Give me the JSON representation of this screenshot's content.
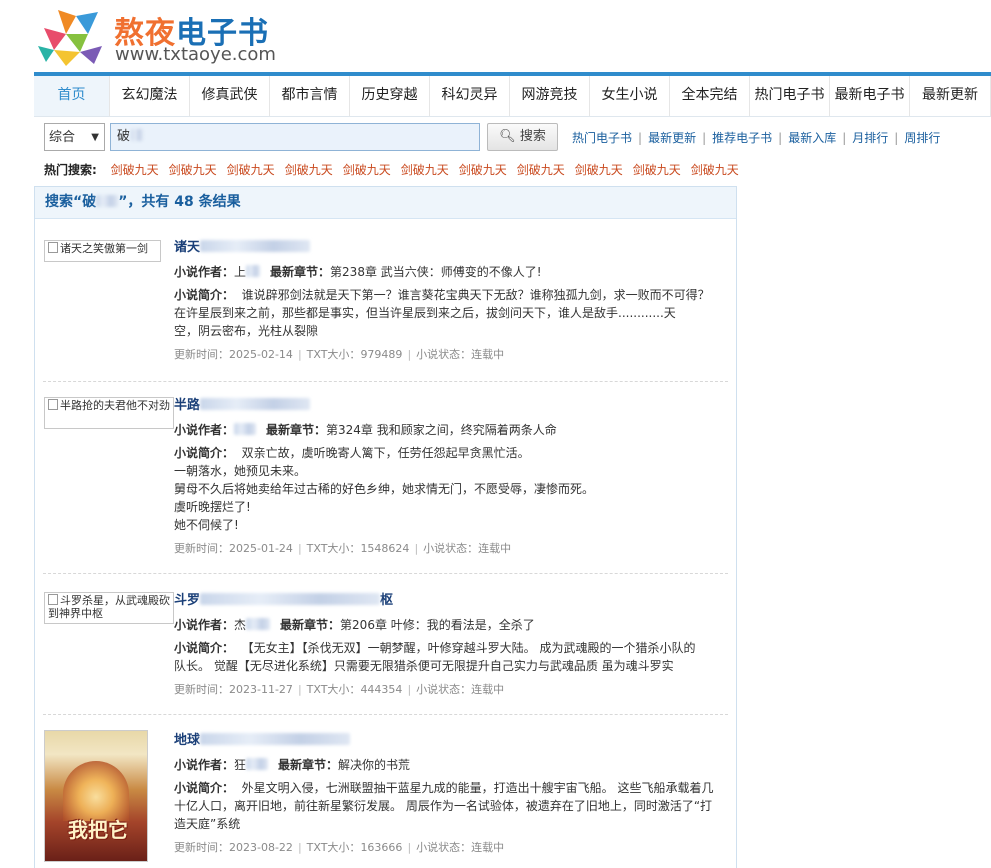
{
  "site": {
    "name_part1": "熬夜",
    "name_part2": "电子书",
    "url": "www.txtaoye.com"
  },
  "nav": [
    {
      "label": "首页",
      "active": true
    },
    {
      "label": "玄幻魔法"
    },
    {
      "label": "修真武侠"
    },
    {
      "label": "都市言情"
    },
    {
      "label": "历史穿越"
    },
    {
      "label": "科幻灵异"
    },
    {
      "label": "网游竞技"
    },
    {
      "label": "女生小说"
    },
    {
      "label": "全本完结"
    },
    {
      "label": "热门电子书"
    },
    {
      "label": "最新电子书"
    },
    {
      "label": "最新更新"
    }
  ],
  "search": {
    "category_selected": "综合",
    "query": "破",
    "button_label": "搜索"
  },
  "quick_links": [
    "热门电子书",
    "最新更新",
    "推荐电子书",
    "最新入库",
    "月排行",
    "周排行"
  ],
  "hot_search": {
    "label": "热门搜索:",
    "items": [
      "剑破九天",
      "剑破九天",
      "剑破九天",
      "剑破九天",
      "剑破九天",
      "剑破九天",
      "剑破九天",
      "剑破九天",
      "剑破九天",
      "剑破九天",
      "剑破九天"
    ]
  },
  "results_header": {
    "prefix": "搜索“破",
    "middle": "”，共有 48 条结果"
  },
  "labels": {
    "author": "小说作者：",
    "latest": "最新章节：",
    "intro": "小说简介：",
    "updated": "更新时间：",
    "size": "TXT大小：",
    "status": "小说状态："
  },
  "results": [
    {
      "thumb_alt": "诸天之笑傲第一剑",
      "title": "诸天",
      "author": "上",
      "latest": "第238章 武当六侠：师傅变的不像人了!",
      "intro": [
        "谁说辟邪剑法就是天下第一？谁言葵花宝典天下无敌？谁称独孤九剑，求一败而不可得？",
        "在许星辰到来之前，那些都是事实，但当许星辰到来之后，拔剑问天下，谁人是敌手............天",
        "空，阴云密布，光柱从裂隙"
      ],
      "updated": "2025-02-14",
      "size": "979489",
      "status": "连载中"
    },
    {
      "thumb_alt": "半路抢的夫君他不对劲",
      "title": "半路",
      "author": "",
      "latest": "第324章 我和顾家之间，终究隔着两条人命",
      "intro": [
        "双亲亡故，虞听晚寄人篱下，任劳任怨起早贪黑忙活。",
        "一朝落水，她预见未来。",
        "舅母不久后将她卖给年过古稀的好色乡绅，她求情无门，不愿受辱，凄惨而死。",
        "虞听晚摆烂了!",
        "她不伺候了!"
      ],
      "updated": "2025-01-24",
      "size": "1548624",
      "status": "连载中"
    },
    {
      "thumb_alt": "斗罗杀星，从武魂殿砍到神界中枢",
      "title": "斗罗",
      "title_end": "枢",
      "author": "杰",
      "latest": "第206章 叶修：我的看法是，全杀了",
      "intro": [
        "【无女主】【杀伐无双】一朝梦醒，叶修穿越斗罗大陆。 成为武魂殿的一个猎杀小队的",
        "队长。 觉醒【无尽进化系统】只需要无限猎杀便可无限提升自己实力与武魂品质 虽为魂斗罗实"
      ],
      "updated": "2023-11-27",
      "size": "444354",
      "status": "连载中"
    },
    {
      "thumb_alt": "",
      "cover_text": "我把它",
      "title": "地球",
      "author": "狂",
      "latest": "解决你的书荒",
      "intro": [
        "外星文明入侵，七洲联盟抽干蓝星九成的能量，打造出十艘宇宙飞船。 这些飞船承载着几",
        "十亿人口，离开旧地，前往新星繁衍发展。 周辰作为一名试验体，被遗弃在了旧地上，同时激活了“打",
        "造天庭”系统"
      ],
      "updated": "2023-08-22",
      "size": "163666",
      "status": "连载中"
    }
  ]
}
